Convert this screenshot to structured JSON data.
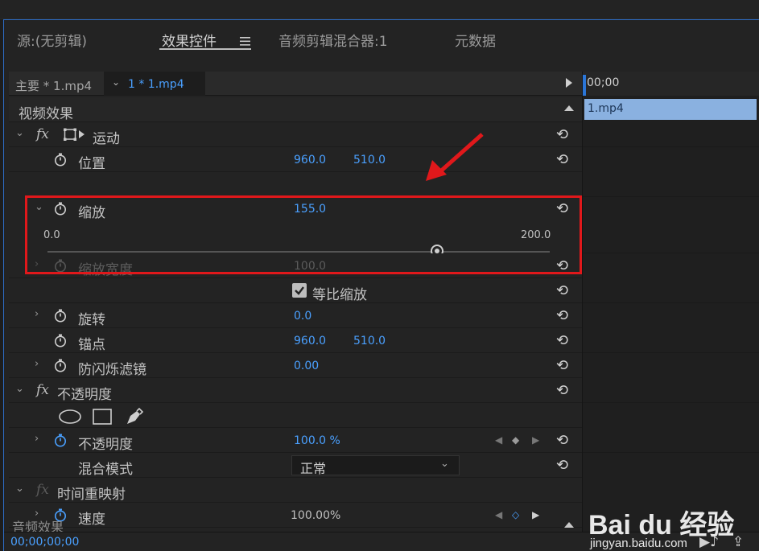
{
  "tabs": [
    {
      "label": "源:(无剪辑)"
    },
    {
      "label": "效果控件"
    },
    {
      "label": "音频剪辑混合器:1"
    },
    {
      "label": "元数据"
    }
  ],
  "tab_menu_icon": "hamburger-icon",
  "clipbar": {
    "master": "主要 * 1.mp4",
    "sequence": "1 * 1.mp4"
  },
  "sections": {
    "video": "视频效果",
    "audio": "音频效果"
  },
  "motion": {
    "label": "运动",
    "position": {
      "label": "位置",
      "x": "960.0",
      "y": "510.0"
    },
    "scale": {
      "label": "缩放",
      "value": "155.0",
      "min": "0.0",
      "max": "200.0",
      "fraction": 0.775
    },
    "scale_width": {
      "label": "缩放宽度",
      "value": "100.0"
    },
    "uniform": {
      "label": "等比缩放",
      "checked": true
    },
    "rotation": {
      "label": "旋转",
      "value": "0.0"
    },
    "anchor": {
      "label": "锚点",
      "x": "960.0",
      "y": "510.0"
    },
    "antiflicker": {
      "label": "防闪烁滤镜",
      "value": "0.00"
    }
  },
  "opacity": {
    "label": "不透明度",
    "value_label": "不透明度",
    "value": "100.0 %",
    "blend_label": "混合模式",
    "blend_value": "正常"
  },
  "time_remap": {
    "label": "时间重映射",
    "speed_label": "速度",
    "speed_value": "100.00%"
  },
  "fx_label": "fx",
  "timeline": {
    "time": "00;00",
    "clip": "1.mp4"
  },
  "footer": {
    "timecode": "00;00;00;00"
  },
  "watermark": {
    "brand": "Bai du 经验",
    "url": "jingyan.baidu.com"
  },
  "colors": {
    "accent": "#4aa0ff",
    "highlight": "#e0181b",
    "clip": "#8ab1e0"
  }
}
